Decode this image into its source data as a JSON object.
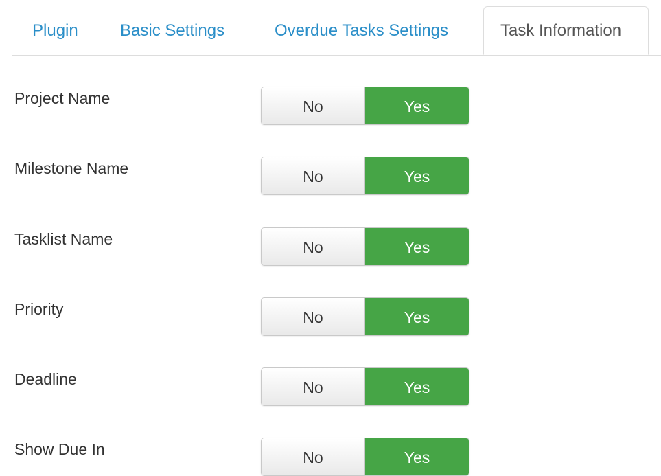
{
  "tabs": [
    {
      "label": "Plugin",
      "active": false
    },
    {
      "label": "Basic Settings",
      "active": false
    },
    {
      "label": "Overdue Tasks Settings",
      "active": false
    },
    {
      "label": "Task Information",
      "active": true
    }
  ],
  "fields": [
    {
      "label": "Project Name",
      "no_label": "No",
      "yes_label": "Yes",
      "value": "Yes"
    },
    {
      "label": "Milestone Name",
      "no_label": "No",
      "yes_label": "Yes",
      "value": "Yes"
    },
    {
      "label": "Tasklist Name",
      "no_label": "No",
      "yes_label": "Yes",
      "value": "Yes"
    },
    {
      "label": "Priority",
      "no_label": "No",
      "yes_label": "Yes",
      "value": "Yes"
    },
    {
      "label": "Deadline",
      "no_label": "No",
      "yes_label": "Yes",
      "value": "Yes"
    },
    {
      "label": "Show Due In",
      "no_label": "No",
      "yes_label": "Yes",
      "value": "Yes"
    }
  ],
  "colors": {
    "tab_link": "#2a8ec8",
    "active_yes": "#46a546",
    "border": "#dddddd"
  }
}
